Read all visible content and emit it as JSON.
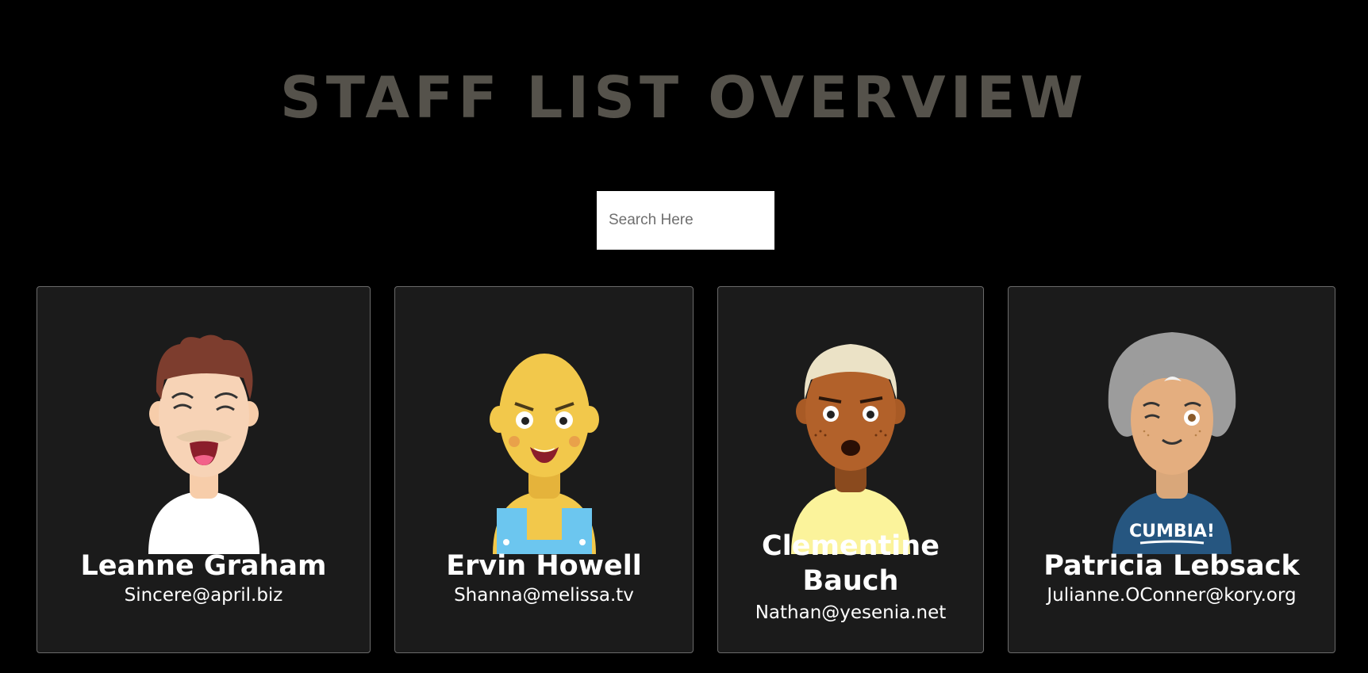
{
  "page_title": "STAFF LIST OVERVIEW",
  "search": {
    "placeholder": "Search Here",
    "value": ""
  },
  "staff": [
    {
      "name": "Leanne Graham",
      "email": "Sincere@april.biz",
      "avatar_icon": "avatar-man-brown-hair-icon"
    },
    {
      "name": "Ervin Howell",
      "email": "Shanna@melissa.tv",
      "avatar_icon": "avatar-bald-yellow-overalls-icon"
    },
    {
      "name": "Clementine Bauch",
      "name_line1": "Clementine",
      "name_line2": "Bauch",
      "email": "Nathan@yesenia.net",
      "avatar_icon": "avatar-dark-skin-blonde-icon"
    },
    {
      "name": "Patricia Lebsack",
      "email": "Julianne.OConner@kory.org",
      "avatar_icon": "avatar-gray-hair-winking-icon",
      "shirt_text": "CUMBIA!"
    }
  ],
  "colors": {
    "background": "#000000",
    "card": "#1b1b1b",
    "title": "#55524b"
  }
}
